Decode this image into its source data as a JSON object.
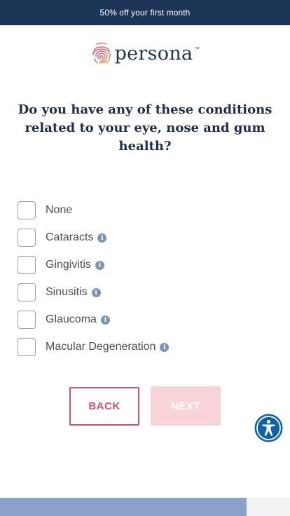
{
  "promo": {
    "text": "50% off your first month"
  },
  "brand": {
    "name": "persona",
    "trademark": "™"
  },
  "question": {
    "text": "Do you have any of these conditions related to your eye, nose and gum health?"
  },
  "options": [
    {
      "label": "None",
      "has_info": false
    },
    {
      "label": "Cataracts",
      "has_info": true
    },
    {
      "label": "Gingivitis",
      "has_info": true
    },
    {
      "label": "Sinusitis",
      "has_info": true
    },
    {
      "label": "Glaucoma",
      "has_info": true
    },
    {
      "label": "Macular Degeneration",
      "has_info": true
    }
  ],
  "buttons": {
    "back": "BACK",
    "next": "NEXT"
  },
  "icons": {
    "info": "info-icon",
    "accessibility": "accessibility-icon",
    "logo": "fingerprint-logo-icon"
  },
  "progress": {
    "fraction": 0.85
  },
  "colors": {
    "banner": "#1d3557",
    "accent": "#d9506a",
    "next_disabled": "#f8d4d9",
    "progress": "#8aa1cc",
    "accessibility": "#0d62a8"
  }
}
